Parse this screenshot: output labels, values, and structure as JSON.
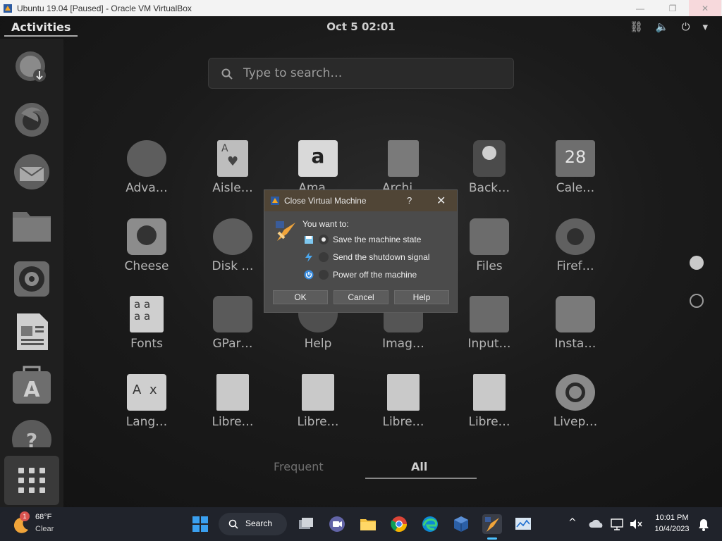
{
  "host_window": {
    "title": "Ubuntu 19.04 [Paused] - Oracle VM VirtualBox",
    "minimize_icon": "minimize-icon",
    "restore_icon": "restore-icon",
    "close_icon": "close-icon"
  },
  "gnome": {
    "activities_label": "Activities",
    "clock": "Oct 5  02:01",
    "tray_icons": [
      "network-icon",
      "volume-icon",
      "power-icon",
      "chevron-down-icon"
    ],
    "search_placeholder": "Type to search…",
    "dock_items": [
      "software-updater-icon",
      "firefox-icon",
      "thunderbird-icon",
      "files-icon",
      "rhythmbox-icon",
      "libreoffice-writer-icon",
      "ubuntu-software-icon",
      "help-icon",
      "show-applications-icon"
    ],
    "apps": [
      {
        "label": "Adva…",
        "icon": "advanced-network-icon"
      },
      {
        "label": "Aisle…",
        "icon": "aisleriot-icon"
      },
      {
        "label": "Ama…",
        "icon": "amazon-icon"
      },
      {
        "label": "Archi…",
        "icon": "archive-manager-icon"
      },
      {
        "label": "Back…",
        "icon": "backups-icon"
      },
      {
        "label": "Cale…",
        "icon": "calendar-icon",
        "badge": "28"
      },
      {
        "label": "Cheese",
        "icon": "cheese-icon"
      },
      {
        "label": "Disk …",
        "icon": "disk-usage-icon"
      },
      {
        "label": "Files",
        "icon": "files-icon"
      },
      {
        "label": "Firef…",
        "icon": "firefox-icon"
      },
      {
        "label": "Fonts",
        "icon": "fonts-icon"
      },
      {
        "label": "GPar…",
        "icon": "gparted-icon"
      },
      {
        "label": "Help",
        "icon": "help-icon"
      },
      {
        "label": "Imag…",
        "icon": "image-viewer-icon"
      },
      {
        "label": "Input…",
        "icon": "input-method-icon"
      },
      {
        "label": "Insta…",
        "icon": "install-icon"
      },
      {
        "label": "Lang…",
        "icon": "language-support-icon"
      },
      {
        "label": "Libre…",
        "icon": "libreoffice-calc-icon"
      },
      {
        "label": "Libre…",
        "icon": "libreoffice-draw-icon"
      },
      {
        "label": "Libre…",
        "icon": "libreoffice-impress-icon"
      },
      {
        "label": "Libre…",
        "icon": "libreoffice-writer-icon"
      },
      {
        "label": "Livep…",
        "icon": "livepatch-icon"
      }
    ],
    "tabs": [
      {
        "label": "Frequent",
        "active": false
      },
      {
        "label": "All",
        "active": true
      }
    ]
  },
  "dialog": {
    "title": "Close Virtual Machine",
    "help_glyph": "?",
    "close_glyph": "✕",
    "prompt": "You want to:",
    "options": [
      {
        "label": "Save the machine state",
        "selected": true,
        "icon": "save-state-icon"
      },
      {
        "label": "Send the shutdown signal",
        "selected": false,
        "icon": "shutdown-signal-icon"
      },
      {
        "label": "Power off the machine",
        "selected": false,
        "icon": "power-off-icon"
      }
    ],
    "buttons": {
      "ok": "OK",
      "cancel": "Cancel",
      "help": "Help"
    }
  },
  "taskbar": {
    "weather_badge": "1",
    "weather_temp": "68°F",
    "weather_cond": "Clear",
    "search_label": "Search",
    "time": "10:01 PM",
    "date": "10/4/2023",
    "accent": "#0078d4"
  }
}
